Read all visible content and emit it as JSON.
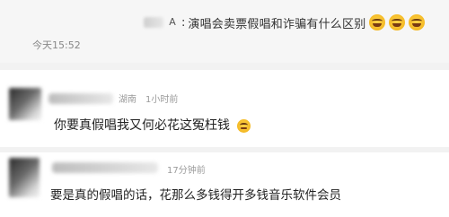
{
  "original_post": {
    "text": "演唱会卖票假唱和诈骗有什么区别",
    "colon": ":",
    "author_badge": "A",
    "emoji_count": 3,
    "emoji_icon": "laughing-emoji",
    "timestamp": "今天15:52"
  },
  "comments": [
    {
      "location": "湖南",
      "time_ago": "1小时前",
      "text": "你要真假唱我又何必花这冤枉钱",
      "emoji_icon": "sad-emoji"
    },
    {
      "time_ago": "17分钟前",
      "text": "要是真的假唱的话，花那么多钱得开多钱音乐软件会员"
    }
  ]
}
